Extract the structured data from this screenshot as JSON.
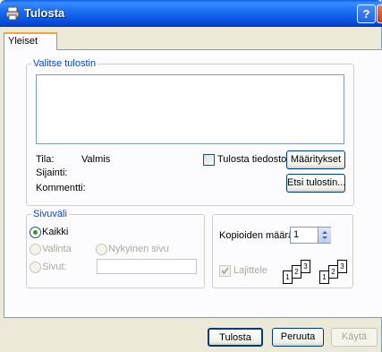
{
  "window": {
    "title": "Tulosta",
    "help_glyph": "?"
  },
  "tabs": [
    {
      "label": "Yleiset"
    }
  ],
  "printer_group": {
    "legend": "Valitse tulostin",
    "status_label": "Tila:",
    "status_value": "Valmis",
    "location_label": "Sijainti:",
    "location_value": "",
    "comment_label": "Kommentti:",
    "comment_value": "",
    "print_to_file_label": "Tulosta tiedostoon",
    "print_to_file_checked": false,
    "preferences_button": "Määritykset",
    "find_printer_button": "Etsi tulostin..."
  },
  "page_range_group": {
    "legend": "Sivuväli",
    "all_label": "Kaikki",
    "all_selected": true,
    "selection_label": "Valinta",
    "current_page_label": "Nykyinen sivu",
    "pages_label": "Sivut:",
    "pages_value": ""
  },
  "copies_group": {
    "copies_label": "Kopioiden määrä:",
    "copies_value": "1",
    "collate_label": "Lajittele",
    "collate_checked": true,
    "collate_pages": [
      "1",
      "2",
      "3"
    ]
  },
  "footer": {
    "print_button": "Tulosta",
    "cancel_button": "Peruuta",
    "apply_button": "Käytä"
  },
  "colors": {
    "titlebar": "#0a5fe4",
    "legend_text": "#0046d5",
    "tab_highlight": "#f1a53d",
    "dialog_bg": "#ece9d8",
    "disabled_text": "#aca899"
  }
}
